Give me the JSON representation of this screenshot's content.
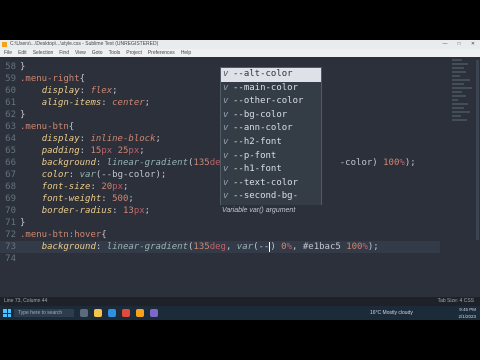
{
  "window": {
    "title": "C:\\Users\\...\\Desktop\\...\\style.css - Sublime Text (UNREGISTERED)",
    "controls": [
      "—",
      "□",
      "✕"
    ]
  },
  "menubar": [
    "File",
    "Edit",
    "Selection",
    "Find",
    "View",
    "Goto",
    "Tools",
    "Project",
    "Preferences",
    "Help"
  ],
  "editor": {
    "lines": [
      {
        "num": "58",
        "tokens": [
          {
            "t": "}",
            "c": "punc"
          }
        ]
      },
      {
        "num": "59",
        "tokens": [
          {
            "t": ".menu-right",
            "c": "sel"
          },
          {
            "t": "{",
            "c": "punc"
          }
        ]
      },
      {
        "num": "60",
        "tokens": [
          {
            "t": "    "
          },
          {
            "t": "display",
            "c": "prop"
          },
          {
            "t": ": ",
            "c": "punc"
          },
          {
            "t": "flex",
            "c": "val"
          },
          {
            "t": ";",
            "c": "punc"
          }
        ]
      },
      {
        "num": "61",
        "tokens": [
          {
            "t": "    "
          },
          {
            "t": "align-items",
            "c": "prop"
          },
          {
            "t": ": ",
            "c": "punc"
          },
          {
            "t": "center",
            "c": "val"
          },
          {
            "t": ";",
            "c": "punc"
          }
        ]
      },
      {
        "num": "62",
        "tokens": [
          {
            "t": "}",
            "c": "punc"
          }
        ]
      },
      {
        "num": "63",
        "tokens": [
          {
            "t": ".menu-btn",
            "c": "sel"
          },
          {
            "t": "{",
            "c": "punc"
          }
        ]
      },
      {
        "num": "64",
        "tokens": [
          {
            "t": "    "
          },
          {
            "t": "display",
            "c": "prop"
          },
          {
            "t": ": ",
            "c": "punc"
          },
          {
            "t": "inline-block",
            "c": "val"
          },
          {
            "t": ";",
            "c": "punc"
          }
        ]
      },
      {
        "num": "65",
        "tokens": [
          {
            "t": "    "
          },
          {
            "t": "padding",
            "c": "prop"
          },
          {
            "t": ": ",
            "c": "punc"
          },
          {
            "t": "15",
            "c": "num"
          },
          {
            "t": "px",
            "c": "unit"
          },
          {
            "t": " "
          },
          {
            "t": "25",
            "c": "num"
          },
          {
            "t": "px",
            "c": "unit"
          },
          {
            "t": ";",
            "c": "punc"
          }
        ]
      },
      {
        "num": "66",
        "tokens": [
          {
            "t": "    "
          },
          {
            "t": "background",
            "c": "prop"
          },
          {
            "t": ": ",
            "c": "punc"
          },
          {
            "t": "linear-gradient",
            "c": "fn"
          },
          {
            "t": "(",
            "c": "punc"
          },
          {
            "t": "135",
            "c": "num"
          },
          {
            "t": "deg",
            "c": "unit"
          },
          {
            "t": ", #e",
            "c": "punc"
          },
          {
            "t": "                 "
          },
          {
            "t": "-color) ",
            "c": "punc"
          },
          {
            "t": "100",
            "c": "num"
          },
          {
            "t": "%",
            "c": "unit"
          },
          {
            "t": ");",
            "c": "punc"
          }
        ]
      },
      {
        "num": "67",
        "tokens": [
          {
            "t": "    "
          },
          {
            "t": "color",
            "c": "prop"
          },
          {
            "t": ": ",
            "c": "punc"
          },
          {
            "t": "var",
            "c": "fn"
          },
          {
            "t": "(--bg-color)",
            "c": "punc"
          },
          {
            "t": ";",
            "c": "punc"
          }
        ]
      },
      {
        "num": "68",
        "tokens": [
          {
            "t": "    "
          },
          {
            "t": "font-size",
            "c": "prop"
          },
          {
            "t": ": ",
            "c": "punc"
          },
          {
            "t": "20",
            "c": "num"
          },
          {
            "t": "px",
            "c": "unit"
          },
          {
            "t": ";",
            "c": "punc"
          }
        ]
      },
      {
        "num": "69",
        "tokens": [
          {
            "t": "    "
          },
          {
            "t": "font-weight",
            "c": "prop"
          },
          {
            "t": ": ",
            "c": "punc"
          },
          {
            "t": "500",
            "c": "num"
          },
          {
            "t": ";",
            "c": "punc"
          }
        ]
      },
      {
        "num": "70",
        "tokens": [
          {
            "t": "    "
          },
          {
            "t": "border-radius",
            "c": "prop"
          },
          {
            "t": ": ",
            "c": "punc"
          },
          {
            "t": "13",
            "c": "num"
          },
          {
            "t": "px",
            "c": "unit"
          },
          {
            "t": ";",
            "c": "punc"
          }
        ]
      },
      {
        "num": "71",
        "tokens": [
          {
            "t": "}",
            "c": "punc"
          }
        ]
      },
      {
        "num": "72",
        "tokens": [
          {
            "t": ".menu-btn",
            "c": "sel"
          },
          {
            "t": ":hover",
            "c": "sel"
          },
          {
            "t": "{",
            "c": "punc"
          }
        ]
      },
      {
        "num": "73",
        "current": true,
        "tokens": [
          {
            "t": "    "
          },
          {
            "t": "background",
            "c": "prop"
          },
          {
            "t": ": ",
            "c": "punc"
          },
          {
            "t": "linear-gradient",
            "c": "fn"
          },
          {
            "t": "(",
            "c": "punc"
          },
          {
            "t": "135",
            "c": "num"
          },
          {
            "t": "deg",
            "c": "unit"
          },
          {
            "t": ", ",
            "c": "punc"
          },
          {
            "t": "var",
            "c": "fn"
          },
          {
            "t": "(--",
            "c": "punc"
          },
          {
            "t": "|CURSOR|"
          },
          {
            "t": ") ",
            "c": "punc"
          },
          {
            "t": "0",
            "c": "num"
          },
          {
            "t": "%",
            "c": "unit"
          },
          {
            "t": ", #e1bac5 ",
            "c": "punc"
          },
          {
            "t": "100",
            "c": "num"
          },
          {
            "t": "%",
            "c": "unit"
          },
          {
            "t": ");",
            "c": "punc"
          }
        ]
      },
      {
        "num": "74",
        "tokens": []
      }
    ]
  },
  "autocomplete": {
    "items": [
      {
        "kind": "v",
        "label": "--alt-color",
        "selected": true
      },
      {
        "kind": "v",
        "label": "--main-color"
      },
      {
        "kind": "v",
        "label": "--other-color"
      },
      {
        "kind": "v",
        "label": "--bg-color"
      },
      {
        "kind": "v",
        "label": "--ann-color"
      },
      {
        "kind": "v",
        "label": "--h2-font"
      },
      {
        "kind": "v",
        "label": "--p-font"
      },
      {
        "kind": "v",
        "label": "--h1-font"
      },
      {
        "kind": "v",
        "label": "--text-color"
      },
      {
        "kind": "v",
        "label": "--second-bg-color"
      }
    ],
    "hint": "Variable var() argument"
  },
  "statusbar": {
    "left": "Line 73, Column 44",
    "right": "Tab Size: 4    CSS"
  },
  "taskbar": {
    "search_placeholder": "Type here to search",
    "weather": "16°C  Mostly cloudy",
    "time": "9:45 PM",
    "date": "2/1/2023"
  },
  "colors": {
    "editor_bg": "#2b303b",
    "accent": "#4cc2ff"
  }
}
